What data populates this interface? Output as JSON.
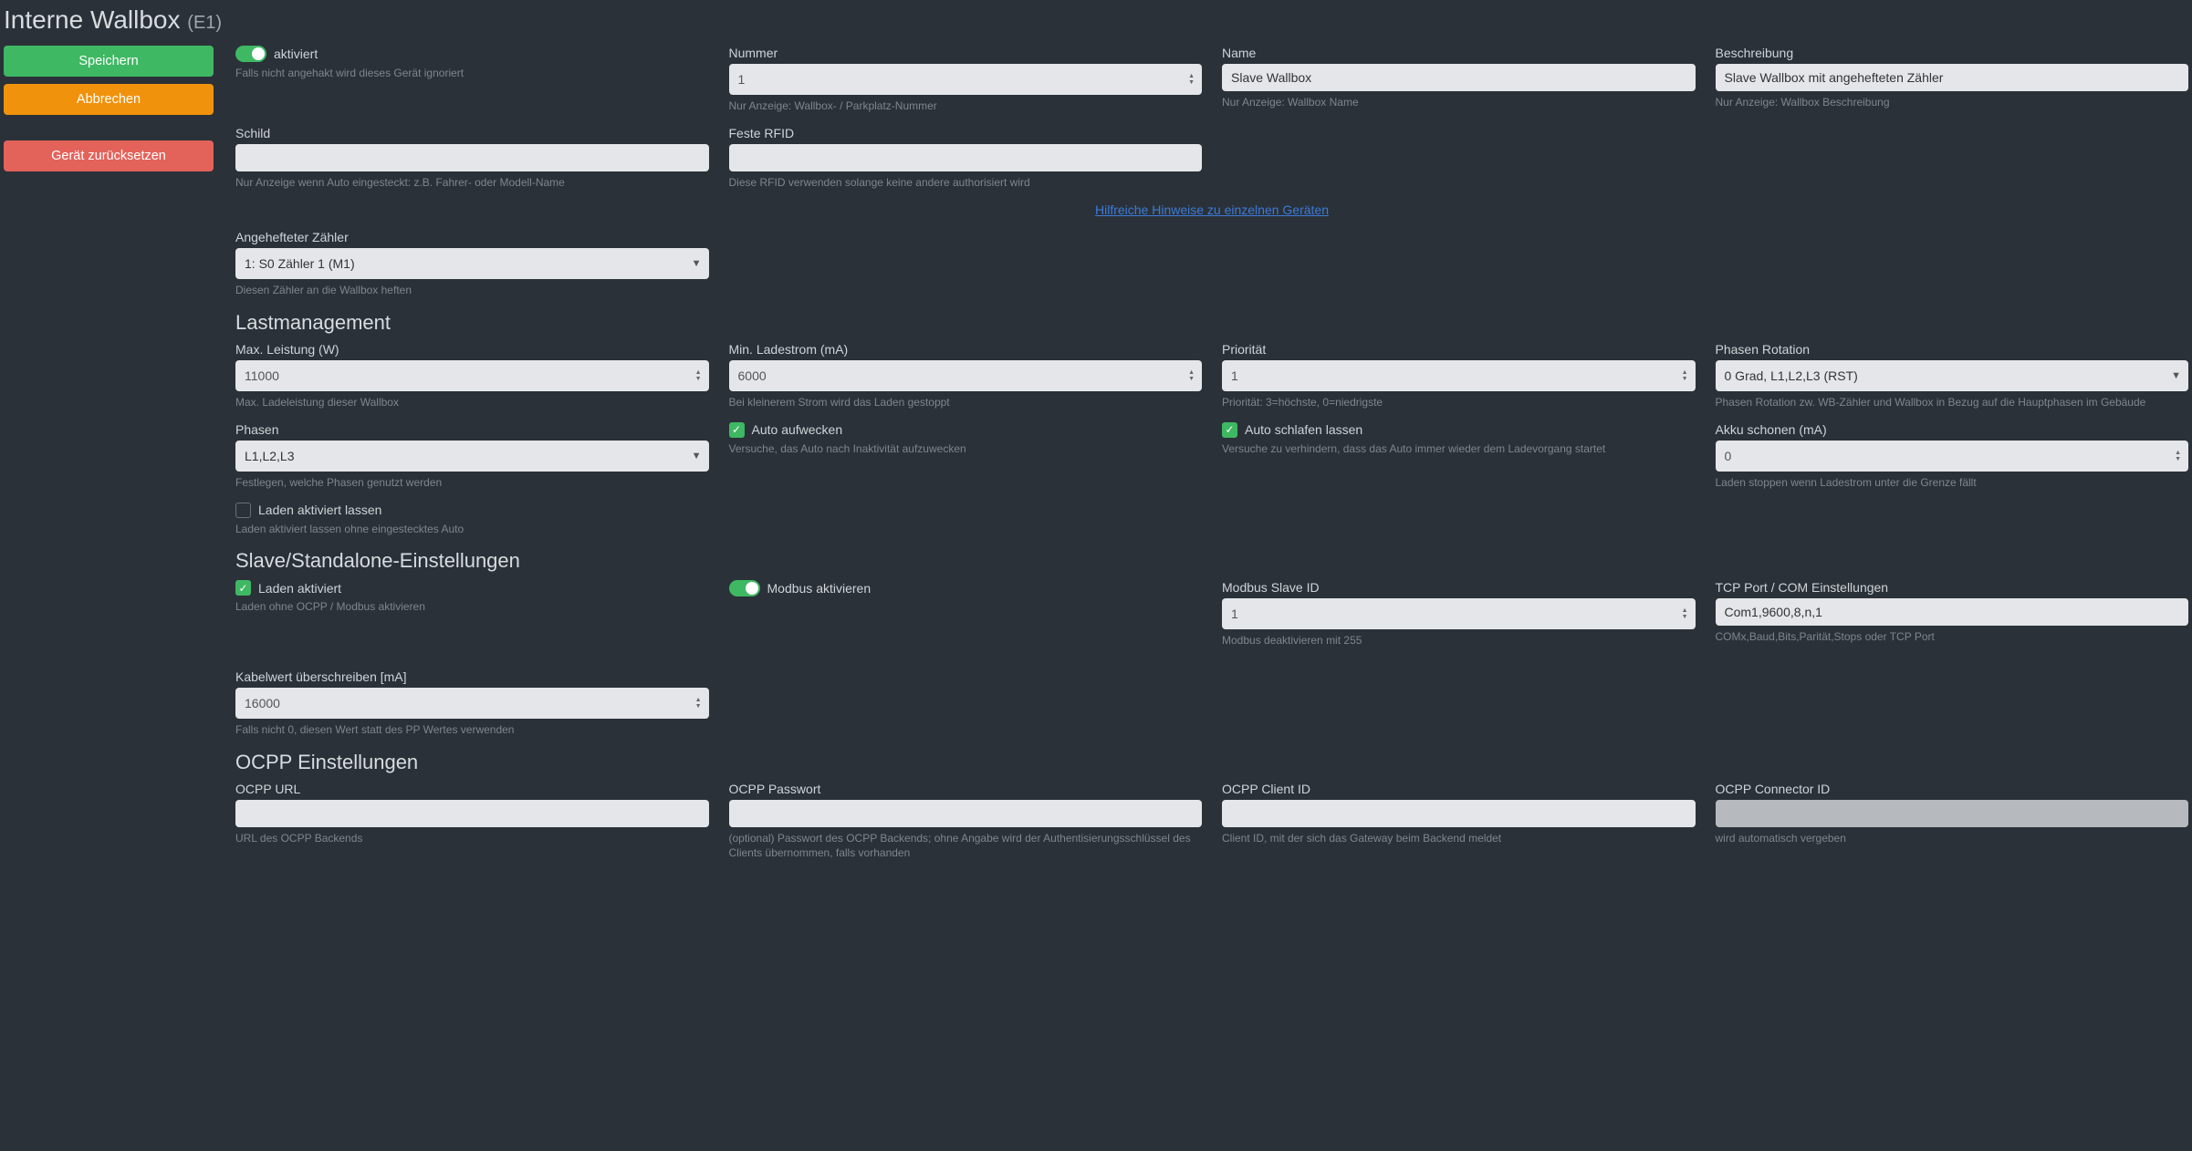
{
  "title": "Interne Wallbox",
  "title_suffix": "(E1)",
  "buttons": {
    "save": "Speichern",
    "cancel": "Abbrechen",
    "reset": "Gerät zurücksetzen"
  },
  "top": {
    "aktiviert": {
      "label": "aktiviert",
      "help": "Falls nicht angehakt wird dieses Gerät ignoriert"
    },
    "nummer": {
      "label": "Nummer",
      "value": "1",
      "help": "Nur Anzeige: Wallbox- / Parkplatz-Nummer"
    },
    "name": {
      "label": "Name",
      "value": "Slave Wallbox",
      "help": "Nur Anzeige: Wallbox Name"
    },
    "beschr": {
      "label": "Beschreibung",
      "value": "Slave Wallbox mit angehefteten Zähler",
      "help": "Nur Anzeige: Wallbox Beschreibung"
    },
    "schild": {
      "label": "Schild",
      "value": "",
      "help": "Nur Anzeige wenn Auto eingesteckt: z.B. Fahrer- oder Modell-Name"
    },
    "rfid": {
      "label": "Feste RFID",
      "value": "",
      "help": "Diese RFID verwenden solange keine andere authorisiert wird"
    }
  },
  "hint_link": "Hilfreiche Hinweise zu einzelnen Geräten",
  "meter": {
    "label": "Angehefteter Zähler",
    "value": "1: S0 Zähler 1 (M1)",
    "help": "Diesen Zähler an die Wallbox heften"
  },
  "lm_title": "Lastmanagement",
  "lm": {
    "max": {
      "label": "Max. Leistung (W)",
      "value": "11000",
      "help": "Max. Ladeleistung dieser Wallbox"
    },
    "min": {
      "label": "Min. Ladestrom (mA)",
      "value": "6000",
      "help": "Bei kleinerem Strom wird das Laden gestoppt"
    },
    "prio": {
      "label": "Priorität",
      "value": "1",
      "help": "Priorität: 3=höchste, 0=niedrigste"
    },
    "rot": {
      "label": "Phasen Rotation",
      "value": "0 Grad, L1,L2,L3 (RST)",
      "help": "Phasen Rotation zw. WB-Zähler und Wallbox in Bezug auf die Hauptphasen im Gebäude"
    },
    "phasen": {
      "label": "Phasen",
      "value": "L1,L2,L3",
      "help": "Festlegen, welche Phasen genutzt werden"
    },
    "wake": {
      "label": "Auto aufwecken",
      "help": "Versuche, das Auto nach Inaktivität aufzuwecken"
    },
    "sleep": {
      "label": "Auto schlafen lassen",
      "help": "Versuche zu verhindern, dass das Auto immer wieder dem Ladevorgang startet"
    },
    "akku": {
      "label": "Akku schonen (mA)",
      "value": "0",
      "help": "Laden stoppen wenn Ladestrom unter die Grenze fällt"
    },
    "keep": {
      "label": "Laden aktiviert lassen",
      "help": "Laden aktiviert lassen ohne eingestecktes Auto"
    }
  },
  "slave_title": "Slave/Standalone-Einstellungen",
  "slave": {
    "enable": {
      "label": "Laden aktiviert",
      "help": "Laden ohne OCPP / Modbus aktivieren"
    },
    "modbus": {
      "label": "Modbus aktivieren"
    },
    "mbid": {
      "label": "Modbus Slave ID",
      "value": "1",
      "help": "Modbus deaktivieren mit 255"
    },
    "tcp": {
      "label": "TCP Port / COM Einstellungen",
      "value": "Com1,9600,8,n,1",
      "help": "COMx,Baud,Bits,Parität,Stops oder TCP Port"
    },
    "cable": {
      "label": "Kabelwert überschreiben [mA]",
      "value": "16000",
      "help": "Falls nicht 0, diesen Wert statt des PP Wertes verwenden"
    }
  },
  "ocpp_title": "OCPP Einstellungen",
  "ocpp": {
    "url": {
      "label": "OCPP URL",
      "value": "",
      "help": "URL des OCPP Backends"
    },
    "pass": {
      "label": "OCPP Passwort",
      "value": "",
      "help": "(optional) Passwort des OCPP Backends; ohne Angabe wird der Authentisierungsschlüssel des Clients übernommen, falls vorhanden"
    },
    "client": {
      "label": "OCPP Client ID",
      "value": "",
      "help": "Client ID, mit der sich das Gateway beim Backend meldet"
    },
    "conn": {
      "label": "OCPP Connector ID",
      "value": "",
      "help": "wird automatisch vergeben"
    }
  }
}
